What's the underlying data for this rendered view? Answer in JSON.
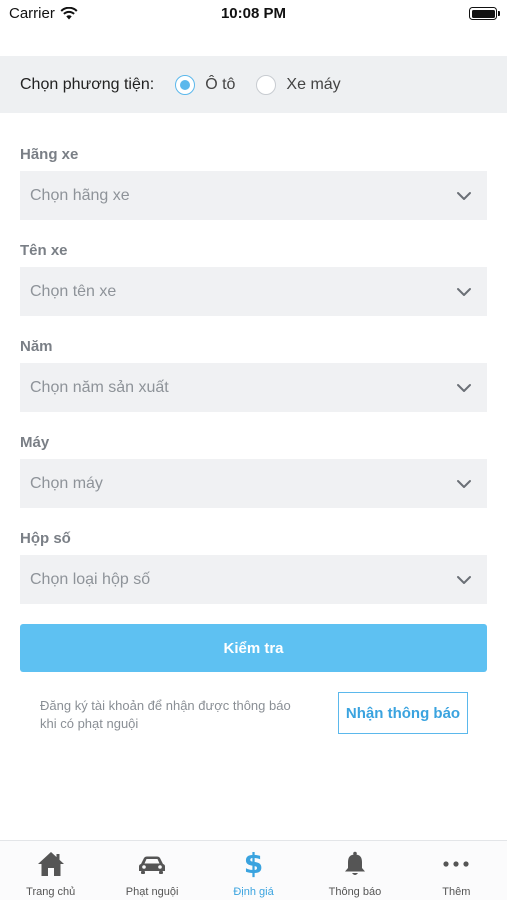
{
  "status_bar": {
    "carrier": "Carrier",
    "time": "10:08 PM"
  },
  "vehicle_type": {
    "label": "Chọn phương tiện:",
    "options": [
      {
        "label": "Ô tô",
        "selected": true
      },
      {
        "label": "Xe máy",
        "selected": false
      }
    ]
  },
  "form": {
    "fields": [
      {
        "label": "Hãng xe",
        "placeholder": "Chọn hãng xe"
      },
      {
        "label": "Tên xe",
        "placeholder": "Chọn tên xe"
      },
      {
        "label": "Năm",
        "placeholder": "Chọn năm sản xuất"
      },
      {
        "label": "Máy",
        "placeholder": "Chọn máy"
      },
      {
        "label": "Hộp số",
        "placeholder": "Chọn loại hộp số"
      }
    ],
    "submit_label": "Kiểm tra"
  },
  "notification": {
    "line1": "Đăng ký tài khoản để nhận được thông báo",
    "line2": "khi có phạt nguội",
    "button_label": "Nhận thông báo"
  },
  "tab_bar": {
    "tabs": [
      {
        "label": "Trang chủ",
        "icon": "home-icon",
        "active": false
      },
      {
        "label": "Phạt nguội",
        "icon": "car-icon",
        "active": false
      },
      {
        "label": "Định giá",
        "icon": "dollar-icon",
        "active": true
      },
      {
        "label": "Thông báo",
        "icon": "bell-icon",
        "active": false
      },
      {
        "label": "Thêm",
        "icon": "more-icon",
        "active": false
      }
    ]
  },
  "colors": {
    "accent": "#5ec1f2",
    "accent_dark": "#3aa3df",
    "field_bg": "#f0f1f3"
  }
}
